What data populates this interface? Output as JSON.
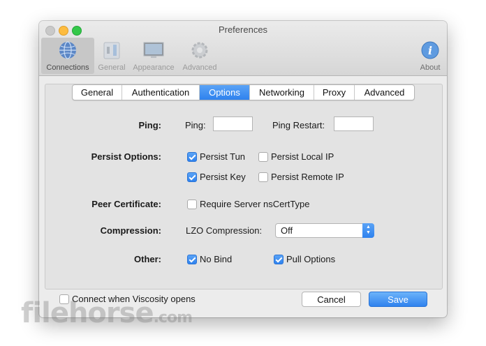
{
  "window": {
    "title": "Preferences"
  },
  "toolbar": [
    {
      "label": "Connections",
      "icon": "connections-globe-icon",
      "active": true
    },
    {
      "label": "General",
      "icon": "general-switch-icon"
    },
    {
      "label": "Appearance",
      "icon": "appearance-monitor-icon"
    },
    {
      "label": "Advanced",
      "icon": "advanced-gear-icon"
    },
    {
      "label": "About",
      "icon": "about-info-icon"
    }
  ],
  "tabs": [
    {
      "label": "General"
    },
    {
      "label": "Authentication"
    },
    {
      "label": "Options",
      "selected": true
    },
    {
      "label": "Networking"
    },
    {
      "label": "Proxy"
    },
    {
      "label": "Advanced"
    }
  ],
  "ping": {
    "section": "Ping:",
    "ping_label": "Ping:",
    "ping_value": "",
    "restart_label": "Ping Restart:",
    "restart_value": ""
  },
  "persist": {
    "section": "Persist Options:",
    "tun": {
      "label": "Persist Tun",
      "checked": true
    },
    "local_ip": {
      "label": "Persist Local IP",
      "checked": false
    },
    "key": {
      "label": "Persist Key",
      "checked": true
    },
    "remote_ip": {
      "label": "Persist Remote IP",
      "checked": false
    }
  },
  "peer_cert": {
    "section": "Peer Certificate:",
    "require": {
      "label": "Require Server nsCertType",
      "checked": false
    }
  },
  "compression": {
    "section": "Compression:",
    "lzo_label": "LZO Compression:",
    "lzo_value": "Off"
  },
  "other": {
    "section": "Other:",
    "no_bind": {
      "label": "No Bind",
      "checked": true
    },
    "pull": {
      "label": "Pull Options",
      "checked": true
    }
  },
  "footer": {
    "connect_label": "Connect when Viscosity opens",
    "connect_checked": false,
    "cancel": "Cancel",
    "save": "Save"
  },
  "watermark": {
    "text": "filehorse",
    "suffix": ".com"
  },
  "colors": {
    "accent": "#2f82ee",
    "window_bg": "#ececec"
  }
}
